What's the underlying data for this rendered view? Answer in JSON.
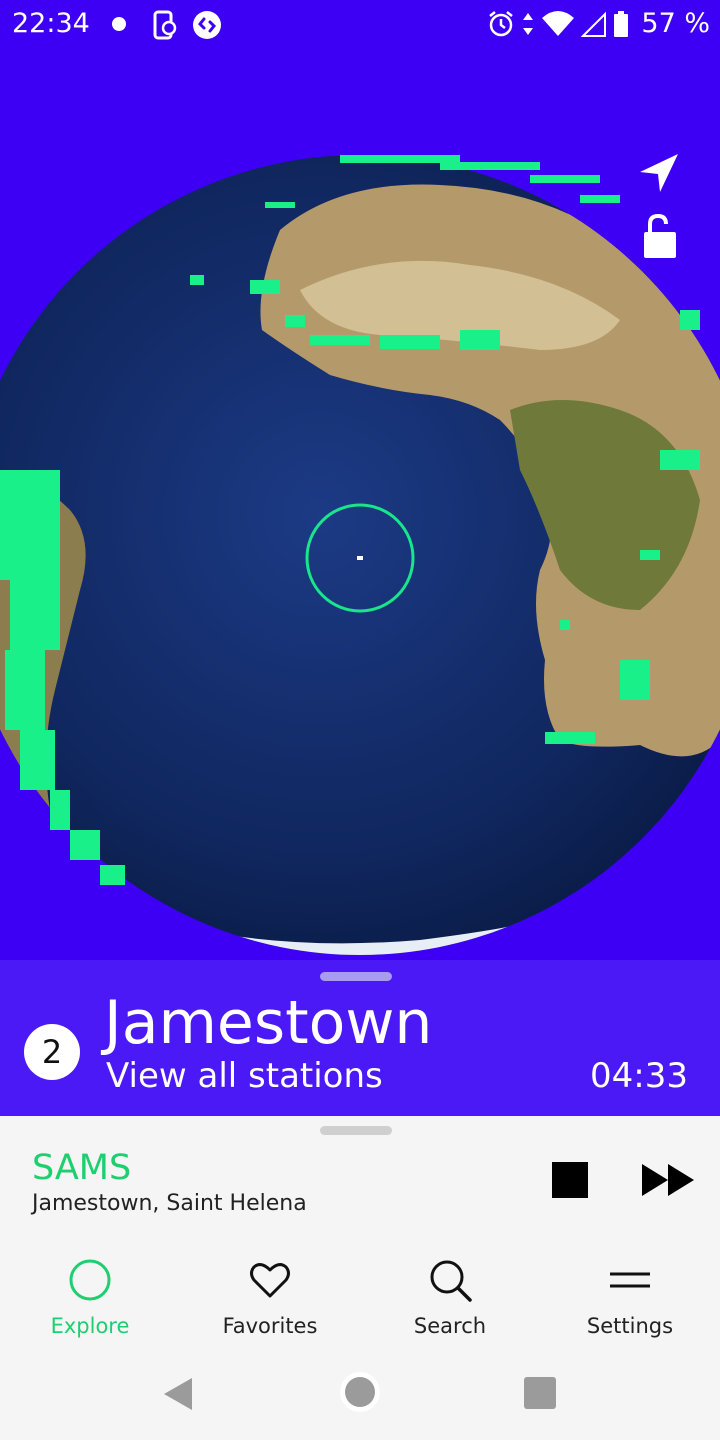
{
  "status_bar": {
    "time": "22:34",
    "battery_percent": "57 %",
    "icons": [
      "notification-dot-icon",
      "phone-sync-icon",
      "shazam-icon",
      "alarm-icon",
      "data-arrows-icon",
      "wifi-icon",
      "cell-signal-icon",
      "battery-icon"
    ]
  },
  "map": {
    "icons": [
      "locate-arrow-icon",
      "unlock-icon"
    ],
    "colors": {
      "background": "#3d00f5",
      "station_dots": "#19f08a",
      "selection_ring": "#19e68a"
    }
  },
  "station_panel": {
    "station_count": "2",
    "city": "Jamestown",
    "view_all_label": "View all stations",
    "local_time": "04:33"
  },
  "now_playing": {
    "station": "SAMS",
    "location": "Jamestown, Saint Helena",
    "icons": [
      "stop-icon",
      "fast-forward-icon"
    ]
  },
  "bottom_nav": {
    "items": [
      {
        "label": "Explore",
        "icon": "explore-circle-icon",
        "active": true
      },
      {
        "label": "Favorites",
        "icon": "heart-icon",
        "active": false
      },
      {
        "label": "Search",
        "icon": "search-icon",
        "active": false
      },
      {
        "label": "Settings",
        "icon": "menu-icon",
        "active": false
      }
    ]
  },
  "colors": {
    "accent": "#1fcf6f",
    "panel": "#4b19f5",
    "bottom_bg": "#f5f5f5"
  }
}
